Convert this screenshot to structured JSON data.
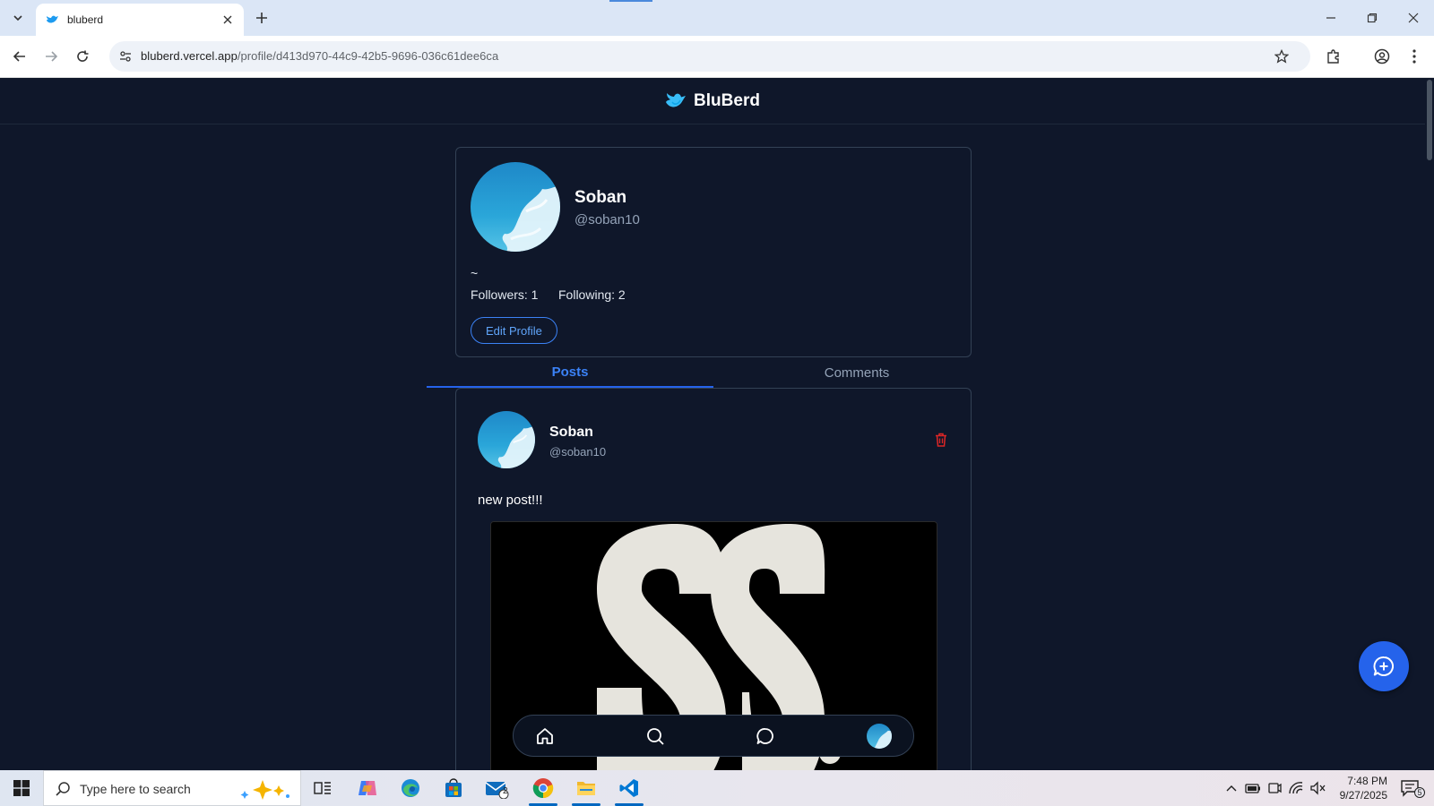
{
  "browser": {
    "tab_title": "bluberd",
    "url_host": "bluberd.vercel.app",
    "url_path": "/profile/d413d970-44c9-42b5-9696-036c61dee6ca"
  },
  "app": {
    "brand": "BluBerd"
  },
  "profile": {
    "name": "Soban",
    "handle": "@soban10",
    "bio": "~",
    "followers": "Followers: 1",
    "following": "Following: 2",
    "edit_label": "Edit Profile"
  },
  "tabs": {
    "posts": "Posts",
    "comments": "Comments"
  },
  "post": {
    "name": "Soban",
    "handle": "@soban10",
    "text": "new post!!!"
  },
  "taskbar": {
    "search_placeholder": "Type here to search",
    "time": "7:48 PM",
    "date": "9/27/2025",
    "mail_badge": "2",
    "notif_count": "5"
  },
  "colors": {
    "page_bg": "#0f172a",
    "accent": "#2563eb",
    "danger": "#dc2626",
    "muted": "#94a3b8"
  }
}
